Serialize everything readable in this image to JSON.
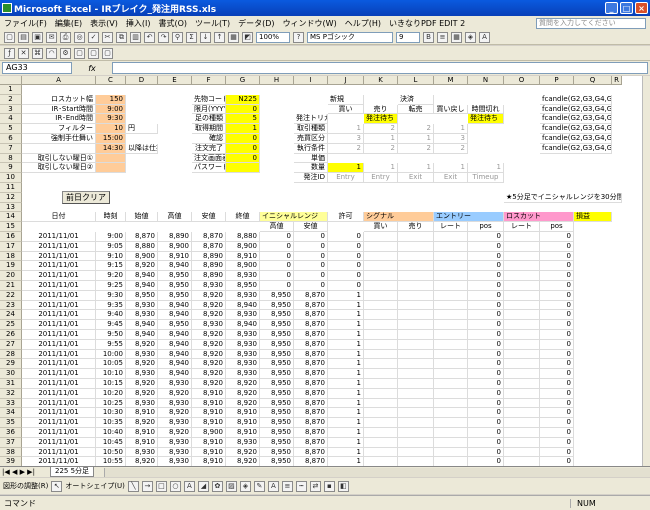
{
  "window": {
    "title": "Microsoft Excel - IRブレイク_発注用RSS.xls"
  },
  "menu": [
    "ファイル(F)",
    "編集(E)",
    "表示(V)",
    "挿入(I)",
    "書式(O)",
    "ツール(T)",
    "データ(D)",
    "ウィンドウ(W)",
    "ヘルプ(H)",
    "いきなりPDF EDIT 2"
  ],
  "help_placeholder": "質問を入力してください",
  "font": {
    "name": "MS Pゴシック",
    "size": "9"
  },
  "zoom": "100%",
  "name_box": "AG33",
  "columns": [
    {
      "l": "A",
      "w": 74
    },
    {
      "l": "C",
      "w": 30
    },
    {
      "l": "D",
      "w": 32
    },
    {
      "l": "E",
      "w": 34
    },
    {
      "l": "F",
      "w": 34
    },
    {
      "l": "G",
      "w": 34
    },
    {
      "l": "H",
      "w": 34
    },
    {
      "l": "I",
      "w": 34
    },
    {
      "l": "J",
      "w": 36
    },
    {
      "l": "K",
      "w": 34
    },
    {
      "l": "L",
      "w": 36
    },
    {
      "l": "M",
      "w": 34
    },
    {
      "l": "N",
      "w": 36
    },
    {
      "l": "O",
      "w": 36
    },
    {
      "l": "P",
      "w": 34
    },
    {
      "l": "Q",
      "w": 38
    },
    {
      "l": "R",
      "w": 10
    }
  ],
  "rows": [
    1,
    2,
    3,
    4,
    5,
    6,
    7,
    8,
    9,
    10,
    11,
    12,
    13,
    14,
    15,
    16,
    17,
    18,
    19,
    20,
    21,
    22,
    23,
    24,
    25,
    26,
    27,
    28,
    29,
    30,
    31,
    32,
    33,
    34,
    35,
    36,
    37,
    38,
    39
  ],
  "params": [
    {
      "label": "ロスカット幅",
      "value": "150"
    },
    {
      "label": "IR･Start時間",
      "value": "9:00"
    },
    {
      "label": "IR･End時間",
      "value": "9:30"
    },
    {
      "label": "フィルター",
      "value": "10",
      "unit": "円"
    },
    {
      "label": "強制手仕舞い",
      "value": "15:00"
    },
    {
      "label": "",
      "value": "14:30",
      "unit": "以降は仕掛けない"
    },
    {
      "label": "取引しない曜日①",
      "value": ""
    },
    {
      "label": "取引しない曜日②",
      "value": ""
    }
  ],
  "settings": [
    {
      "label": "先物コード",
      "value": "N225"
    },
    {
      "label": "限月(YYYYMM)",
      "value": "0"
    },
    {
      "label": "足の種類",
      "value": "5"
    },
    {
      "label": "取得期間",
      "value": "1"
    },
    {
      "label": "確認",
      "value": "0"
    },
    {
      "label": "注文完了",
      "value": "0"
    },
    {
      "label": "注文画面表示",
      "value": "0"
    },
    {
      "label": "パスワード",
      "value": ""
    }
  ],
  "order": {
    "headers": {
      "new": "新規",
      "settle": "決済",
      "buy": "買い",
      "sell": "売り",
      "reverse": "転売",
      "buyback": "買い戻し",
      "timeout": "時間切れ"
    },
    "labels": [
      "発注トリガー",
      "取引種類",
      "売買区分",
      "執行条件",
      "単価",
      "数量",
      "発注ID"
    ],
    "trigger": "発注待ち",
    "kind": [
      "1",
      "2",
      "2",
      "1"
    ],
    "side": [
      "3",
      "1",
      "1",
      "3"
    ],
    "cond": [
      "2",
      "2",
      "2",
      "2"
    ],
    "qty": [
      "1",
      "1",
      "1",
      "1",
      "1"
    ],
    "ids": [
      "Entry",
      "Entry",
      "Exit",
      "Exit",
      "Timeup"
    ]
  },
  "candles": [
    "fcandle(G2,G3,G4,G5,\"取引",
    "fcandle(G2,G3,G4,G5,\"約定",
    "fcandle(G2,G3,G4,G5,\"始値",
    "fcandle(G2,G3,G4,G5,\"高値",
    "fcandle(G2,G3,G4,G5,\"安値",
    "fcandle(G2,G3,G4,G5,\"終値"
  ],
  "note": "★5分足でイニシャルレンジを30分間",
  "clear_button": "前日クリア",
  "table": {
    "h1": {
      "date": "日付",
      "time": "時刻",
      "open": "始値",
      "high": "高値",
      "low": "安値",
      "close": "終値",
      "ir": "イニシャルレンジ",
      "allow": "許可",
      "signal": "シグナル",
      "entry": "エントリー",
      "loss": "ロスカット",
      "pl": "損益"
    },
    "h2": {
      "ir_high": "高値",
      "ir_low": "安値",
      "buy": "買い",
      "sell": "売り",
      "rate": "レート",
      "pos": "pos",
      "lrate": "レート",
      "lpos": "pos"
    },
    "rows": [
      [
        "2011/11/01",
        "9:00",
        "8,870",
        "8,890",
        "8,870",
        "8,880",
        "0",
        "0",
        "0",
        "",
        "",
        "",
        "0",
        "",
        "0"
      ],
      [
        "2011/11/01",
        "9:05",
        "8,880",
        "8,900",
        "8,870",
        "8,900",
        "0",
        "0",
        "0",
        "",
        "",
        "",
        "0",
        "",
        "0"
      ],
      [
        "2011/11/01",
        "9:10",
        "8,900",
        "8,910",
        "8,890",
        "8,910",
        "0",
        "0",
        "0",
        "",
        "",
        "",
        "0",
        "",
        "0"
      ],
      [
        "2011/11/01",
        "9:15",
        "8,920",
        "8,940",
        "8,890",
        "8,900",
        "0",
        "0",
        "0",
        "",
        "",
        "",
        "0",
        "",
        "0"
      ],
      [
        "2011/11/01",
        "9:20",
        "8,940",
        "8,950",
        "8,890",
        "8,930",
        "0",
        "0",
        "0",
        "",
        "",
        "",
        "0",
        "",
        "0"
      ],
      [
        "2011/11/01",
        "9:25",
        "8,940",
        "8,950",
        "8,930",
        "8,950",
        "0",
        "0",
        "0",
        "",
        "",
        "",
        "0",
        "",
        "0"
      ],
      [
        "2011/11/01",
        "9:30",
        "8,950",
        "8,950",
        "8,920",
        "8,930",
        "8,950",
        "8,870",
        "1",
        "",
        "",
        "",
        "0",
        "",
        "0"
      ],
      [
        "2011/11/01",
        "9:35",
        "8,930",
        "8,940",
        "8,920",
        "8,940",
        "8,950",
        "8,870",
        "1",
        "",
        "",
        "",
        "0",
        "",
        "0"
      ],
      [
        "2011/11/01",
        "9:40",
        "8,930",
        "8,940",
        "8,920",
        "8,930",
        "8,950",
        "8,870",
        "1",
        "",
        "",
        "",
        "0",
        "",
        "0"
      ],
      [
        "2011/11/01",
        "9:45",
        "8,940",
        "8,950",
        "8,930",
        "8,940",
        "8,950",
        "8,870",
        "1",
        "",
        "",
        "",
        "0",
        "",
        "0"
      ],
      [
        "2011/11/01",
        "9:50",
        "8,940",
        "8,940",
        "8,920",
        "8,930",
        "8,950",
        "8,870",
        "1",
        "",
        "",
        "",
        "0",
        "",
        "0"
      ],
      [
        "2011/11/01",
        "9:55",
        "8,920",
        "8,940",
        "8,920",
        "8,930",
        "8,950",
        "8,870",
        "1",
        "",
        "",
        "",
        "0",
        "",
        "0"
      ],
      [
        "2011/11/01",
        "10:00",
        "8,930",
        "8,940",
        "8,920",
        "8,930",
        "8,950",
        "8,870",
        "1",
        "",
        "",
        "",
        "0",
        "",
        "0"
      ],
      [
        "2011/11/01",
        "10:05",
        "8,920",
        "8,940",
        "8,920",
        "8,930",
        "8,950",
        "8,870",
        "1",
        "",
        "",
        "",
        "0",
        "",
        "0"
      ],
      [
        "2011/11/01",
        "10:10",
        "8,930",
        "8,940",
        "8,920",
        "8,930",
        "8,950",
        "8,870",
        "1",
        "",
        "",
        "",
        "0",
        "",
        "0"
      ],
      [
        "2011/11/01",
        "10:15",
        "8,920",
        "8,930",
        "8,920",
        "8,920",
        "8,950",
        "8,870",
        "1",
        "",
        "",
        "",
        "0",
        "",
        "0"
      ],
      [
        "2011/11/01",
        "10:20",
        "8,920",
        "8,920",
        "8,910",
        "8,920",
        "8,950",
        "8,870",
        "1",
        "",
        "",
        "",
        "0",
        "",
        "0"
      ],
      [
        "2011/11/01",
        "10:25",
        "8,930",
        "8,930",
        "8,910",
        "8,920",
        "8,950",
        "8,870",
        "1",
        "",
        "",
        "",
        "0",
        "",
        "0"
      ],
      [
        "2011/11/01",
        "10:30",
        "8,910",
        "8,920",
        "8,910",
        "8,910",
        "8,950",
        "8,870",
        "1",
        "",
        "",
        "",
        "0",
        "",
        "0"
      ],
      [
        "2011/11/01",
        "10:35",
        "8,920",
        "8,930",
        "8,910",
        "8,910",
        "8,950",
        "8,870",
        "1",
        "",
        "",
        "",
        "0",
        "",
        "0"
      ],
      [
        "2011/11/01",
        "10:40",
        "8,910",
        "8,920",
        "8,900",
        "8,910",
        "8,950",
        "8,870",
        "1",
        "",
        "",
        "",
        "0",
        "",
        "0"
      ],
      [
        "2011/11/01",
        "10:45",
        "8,910",
        "8,930",
        "8,910",
        "8,930",
        "8,950",
        "8,870",
        "1",
        "",
        "",
        "",
        "0",
        "",
        "0"
      ],
      [
        "2011/11/01",
        "10:50",
        "8,930",
        "8,930",
        "8,910",
        "8,920",
        "8,950",
        "8,870",
        "1",
        "",
        "",
        "",
        "0",
        "",
        "0"
      ],
      [
        "2011/11/01",
        "10:55",
        "8,920",
        "8,930",
        "8,910",
        "8,920",
        "8,950",
        "8,870",
        "1",
        "",
        "",
        "",
        "0",
        "",
        "0"
      ]
    ]
  },
  "sheet_tab": "225 5分足",
  "drawbar": {
    "draw": "図形の調整(R)",
    "autoshape": "オートシェイプ(U)"
  },
  "status": {
    "mode": "コマンド",
    "num": "NUM"
  }
}
